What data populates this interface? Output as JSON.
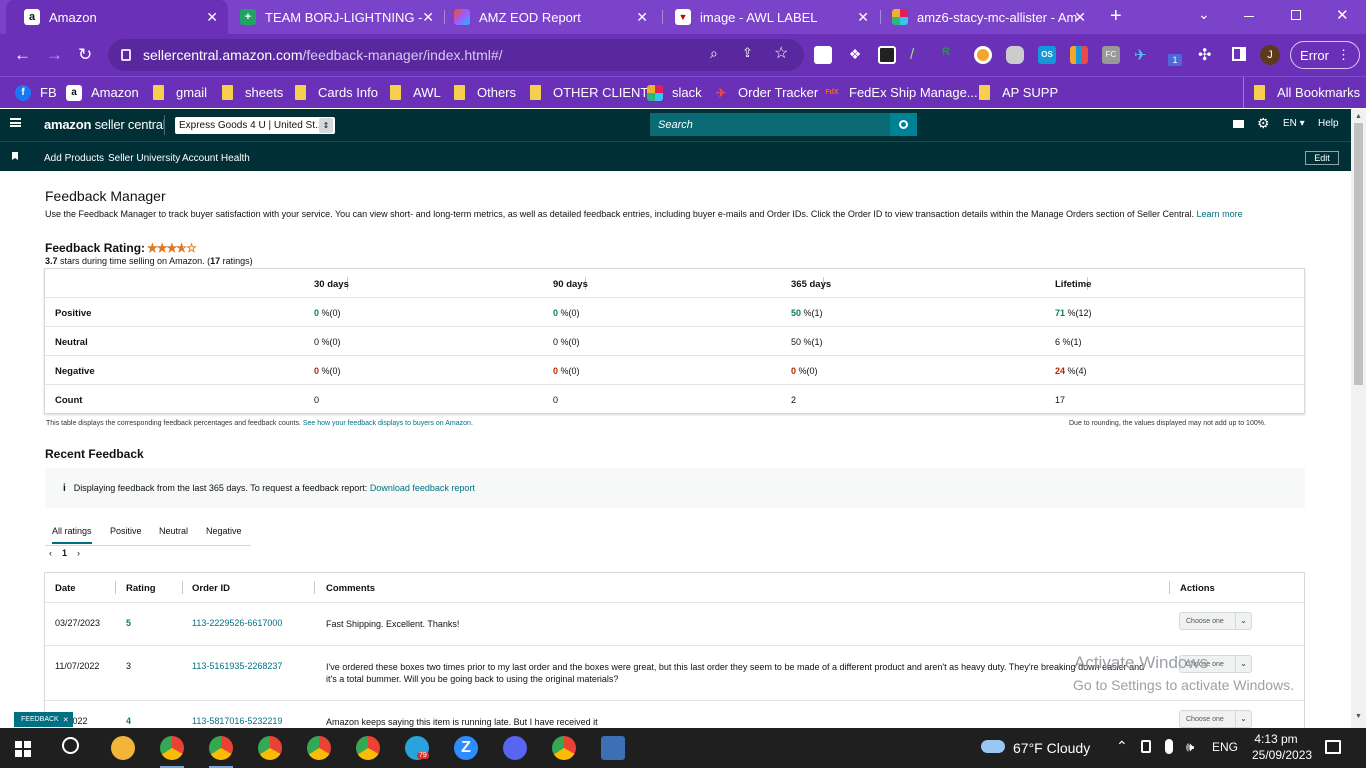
{
  "browser": {
    "tabs": [
      {
        "title": "Amazon",
        "icon": "amazon-icon",
        "active": true
      },
      {
        "title": "TEAM BORJ-LIGHTNING - Go",
        "icon": "sheets-icon"
      },
      {
        "title": "AMZ EOD Report",
        "icon": "figma-icon"
      },
      {
        "title": "image - AWL LABEL",
        "icon": "awl-icon"
      },
      {
        "title": "amz6-stacy-mc-allister - Am",
        "icon": "slack-icon"
      }
    ],
    "new_tab": "+",
    "url": "sellercentral.amazon.com",
    "url_path": "/feedback-manager/index.html#/",
    "error_label": "Error",
    "profile_initial": "J",
    "ext_badge": "1",
    "bookmarks": [
      {
        "label": "FB",
        "icon": "facebook-icon"
      },
      {
        "label": "Amazon",
        "icon": "amazon-icon"
      },
      {
        "label": "gmail",
        "icon": "folder-icon"
      },
      {
        "label": "sheets",
        "icon": "folder-icon"
      },
      {
        "label": "Cards Info",
        "icon": "folder-icon"
      },
      {
        "label": "AWL",
        "icon": "folder-icon"
      },
      {
        "label": "Others",
        "icon": "folder-icon"
      },
      {
        "label": "OTHER CLIENT",
        "icon": "folder-icon"
      },
      {
        "label": "slack",
        "icon": "slack-icon"
      },
      {
        "label": "Order Tracker",
        "icon": "plane-icon"
      },
      {
        "label": "FedEx Ship Manage...",
        "icon": "fedex-icon"
      },
      {
        "label": "AP SUPP",
        "icon": "folder-icon"
      }
    ],
    "all_bookmarks": "All Bookmarks"
  },
  "seller_header": {
    "logo_main": "amazon",
    "logo_sub": " seller central",
    "account": "Express Goods 4 U | United St...",
    "search_placeholder": "Search",
    "language": "EN",
    "help": "Help",
    "nav": [
      "Add Products",
      "Seller University",
      "Account Health"
    ],
    "edit": "Edit"
  },
  "page": {
    "title": "Feedback Manager",
    "description": "Use the Feedback Manager to track buyer satisfaction with your service. You can view short- and long-term metrics, as well as detailed feedback entries, including buyer e-mails and Order IDs. Click the Order ID to view transaction details within the Manage Orders section of Seller Central.",
    "learn_more": "Learn more",
    "rating_label": "Feedback Rating:",
    "rating_value": "3.7",
    "rating_stars_fraction": 0.74,
    "rating_text_pre": " stars during time selling on Amazon. (",
    "rating_count": "17",
    "rating_text_post": " ratings)",
    "metrics": {
      "headers": [
        "30 days",
        "90 days",
        "365 days",
        "Lifetime"
      ],
      "rows": [
        {
          "label": "Positive",
          "style": "g",
          "cells": [
            [
              "0",
              " %(0)"
            ],
            [
              "0",
              " %(0)"
            ],
            [
              "50",
              " %(1)"
            ],
            [
              "71",
              " %(12)"
            ]
          ]
        },
        {
          "label": "Neutral",
          "style": "",
          "cells": [
            [
              "0",
              " %(0)"
            ],
            [
              "0",
              " %(0)"
            ],
            [
              "50",
              " %(1)"
            ],
            [
              "6",
              " %(1)"
            ]
          ]
        },
        {
          "label": "Negative",
          "style": "r",
          "cells": [
            [
              "0",
              " %(0)"
            ],
            [
              "0",
              " %(0)"
            ],
            [
              "0",
              " %(0)"
            ],
            [
              "24",
              " %(4)"
            ]
          ]
        },
        {
          "label": "Count",
          "style": "",
          "cells": [
            [
              "0",
              ""
            ],
            [
              "0",
              ""
            ],
            [
              "2",
              ""
            ],
            [
              "17",
              ""
            ]
          ]
        }
      ]
    },
    "note_left": "This table displays the corresponding feedback percentages and feedback counts.",
    "note_left_link": "See how your feedback displays to buyers on Amazon.",
    "note_right": "Due to rounding, the values displayed may not add up to 100%.",
    "recent_title": "Recent Feedback",
    "info_icon": "i",
    "info_text": "Displaying feedback from the last 365 days. To request a feedback report:",
    "info_link": "Download feedback report",
    "filter_tabs": [
      "All ratings",
      "Positive",
      "Neutral",
      "Negative"
    ],
    "pager": {
      "prev": "‹",
      "current": "1",
      "next": "›"
    },
    "feedback_headers": [
      "Date",
      "Rating",
      "Order ID",
      "Comments",
      "Actions"
    ],
    "feedback": [
      {
        "date": "03/27/2023",
        "rating": "5",
        "order": "113-2229526-6617000",
        "comment": "Fast Shipping. Excellent. Thanks!",
        "action": "Choose one"
      },
      {
        "date": "11/07/2022",
        "rating": "3",
        "order": "113-5161935-2268237",
        "comment": "I've ordered these boxes two times prior to my last order and the boxes were great, but this last order they seem to be made of a different product and aren't as heavy duty. They're breaking down easier and it's a total bummer. Will you be going back to using the original materials?",
        "action": "Choose one"
      },
      {
        "date": "07/2022",
        "rating": "4",
        "order": "113-5817016-5232219",
        "comment": "Amazon keeps saying this item is running late. But I have received it",
        "action": "Choose one"
      }
    ],
    "feedback_badge": "FEEDBACK",
    "activate_line1": "Activate Windows",
    "activate_line2": "Go to Settings to activate Windows."
  },
  "taskbar": {
    "weather": "67°F  Cloudy",
    "lang": "ENG",
    "time": "4:13 pm",
    "date": "25/09/2023",
    "telegram_badge": "79"
  }
}
